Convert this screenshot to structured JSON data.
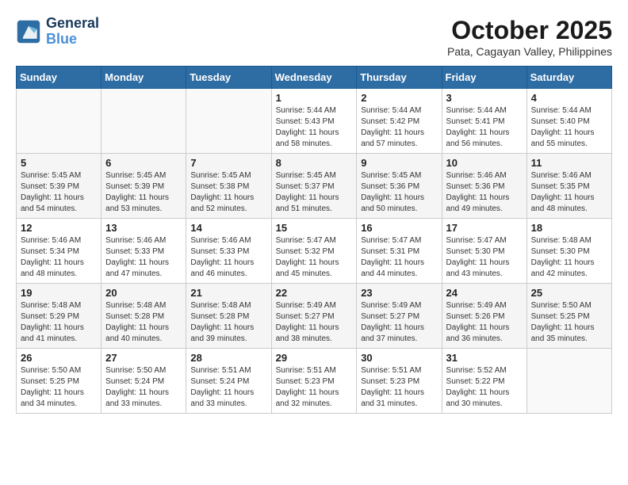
{
  "header": {
    "logo_line1": "General",
    "logo_line2": "Blue",
    "month": "October 2025",
    "location": "Pata, Cagayan Valley, Philippines"
  },
  "weekdays": [
    "Sunday",
    "Monday",
    "Tuesday",
    "Wednesday",
    "Thursday",
    "Friday",
    "Saturday"
  ],
  "weeks": [
    [
      {
        "day": "",
        "info": ""
      },
      {
        "day": "",
        "info": ""
      },
      {
        "day": "",
        "info": ""
      },
      {
        "day": "1",
        "info": "Sunrise: 5:44 AM\nSunset: 5:43 PM\nDaylight: 11 hours\nand 58 minutes."
      },
      {
        "day": "2",
        "info": "Sunrise: 5:44 AM\nSunset: 5:42 PM\nDaylight: 11 hours\nand 57 minutes."
      },
      {
        "day": "3",
        "info": "Sunrise: 5:44 AM\nSunset: 5:41 PM\nDaylight: 11 hours\nand 56 minutes."
      },
      {
        "day": "4",
        "info": "Sunrise: 5:44 AM\nSunset: 5:40 PM\nDaylight: 11 hours\nand 55 minutes."
      }
    ],
    [
      {
        "day": "5",
        "info": "Sunrise: 5:45 AM\nSunset: 5:39 PM\nDaylight: 11 hours\nand 54 minutes."
      },
      {
        "day": "6",
        "info": "Sunrise: 5:45 AM\nSunset: 5:39 PM\nDaylight: 11 hours\nand 53 minutes."
      },
      {
        "day": "7",
        "info": "Sunrise: 5:45 AM\nSunset: 5:38 PM\nDaylight: 11 hours\nand 52 minutes."
      },
      {
        "day": "8",
        "info": "Sunrise: 5:45 AM\nSunset: 5:37 PM\nDaylight: 11 hours\nand 51 minutes."
      },
      {
        "day": "9",
        "info": "Sunrise: 5:45 AM\nSunset: 5:36 PM\nDaylight: 11 hours\nand 50 minutes."
      },
      {
        "day": "10",
        "info": "Sunrise: 5:46 AM\nSunset: 5:36 PM\nDaylight: 11 hours\nand 49 minutes."
      },
      {
        "day": "11",
        "info": "Sunrise: 5:46 AM\nSunset: 5:35 PM\nDaylight: 11 hours\nand 48 minutes."
      }
    ],
    [
      {
        "day": "12",
        "info": "Sunrise: 5:46 AM\nSunset: 5:34 PM\nDaylight: 11 hours\nand 48 minutes."
      },
      {
        "day": "13",
        "info": "Sunrise: 5:46 AM\nSunset: 5:33 PM\nDaylight: 11 hours\nand 47 minutes."
      },
      {
        "day": "14",
        "info": "Sunrise: 5:46 AM\nSunset: 5:33 PM\nDaylight: 11 hours\nand 46 minutes."
      },
      {
        "day": "15",
        "info": "Sunrise: 5:47 AM\nSunset: 5:32 PM\nDaylight: 11 hours\nand 45 minutes."
      },
      {
        "day": "16",
        "info": "Sunrise: 5:47 AM\nSunset: 5:31 PM\nDaylight: 11 hours\nand 44 minutes."
      },
      {
        "day": "17",
        "info": "Sunrise: 5:47 AM\nSunset: 5:30 PM\nDaylight: 11 hours\nand 43 minutes."
      },
      {
        "day": "18",
        "info": "Sunrise: 5:48 AM\nSunset: 5:30 PM\nDaylight: 11 hours\nand 42 minutes."
      }
    ],
    [
      {
        "day": "19",
        "info": "Sunrise: 5:48 AM\nSunset: 5:29 PM\nDaylight: 11 hours\nand 41 minutes."
      },
      {
        "day": "20",
        "info": "Sunrise: 5:48 AM\nSunset: 5:28 PM\nDaylight: 11 hours\nand 40 minutes."
      },
      {
        "day": "21",
        "info": "Sunrise: 5:48 AM\nSunset: 5:28 PM\nDaylight: 11 hours\nand 39 minutes."
      },
      {
        "day": "22",
        "info": "Sunrise: 5:49 AM\nSunset: 5:27 PM\nDaylight: 11 hours\nand 38 minutes."
      },
      {
        "day": "23",
        "info": "Sunrise: 5:49 AM\nSunset: 5:27 PM\nDaylight: 11 hours\nand 37 minutes."
      },
      {
        "day": "24",
        "info": "Sunrise: 5:49 AM\nSunset: 5:26 PM\nDaylight: 11 hours\nand 36 minutes."
      },
      {
        "day": "25",
        "info": "Sunrise: 5:50 AM\nSunset: 5:25 PM\nDaylight: 11 hours\nand 35 minutes."
      }
    ],
    [
      {
        "day": "26",
        "info": "Sunrise: 5:50 AM\nSunset: 5:25 PM\nDaylight: 11 hours\nand 34 minutes."
      },
      {
        "day": "27",
        "info": "Sunrise: 5:50 AM\nSunset: 5:24 PM\nDaylight: 11 hours\nand 33 minutes."
      },
      {
        "day": "28",
        "info": "Sunrise: 5:51 AM\nSunset: 5:24 PM\nDaylight: 11 hours\nand 33 minutes."
      },
      {
        "day": "29",
        "info": "Sunrise: 5:51 AM\nSunset: 5:23 PM\nDaylight: 11 hours\nand 32 minutes."
      },
      {
        "day": "30",
        "info": "Sunrise: 5:51 AM\nSunset: 5:23 PM\nDaylight: 11 hours\nand 31 minutes."
      },
      {
        "day": "31",
        "info": "Sunrise: 5:52 AM\nSunset: 5:22 PM\nDaylight: 11 hours\nand 30 minutes."
      },
      {
        "day": "",
        "info": ""
      }
    ]
  ]
}
